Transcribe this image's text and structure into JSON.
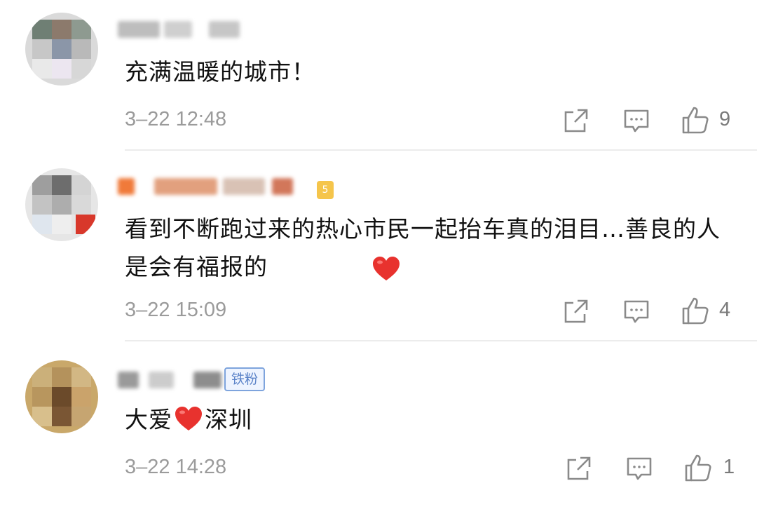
{
  "comments": [
    {
      "text": "充满温暖的城市！",
      "time": "3–22 12:48",
      "likes": "9"
    },
    {
      "text": "看到不断跑过来的热心市民一起抬车真的泪目…善良的人是会有福报的",
      "time": "3–22 15:09",
      "likes": "4"
    },
    {
      "text_before": "大爱",
      "text_after": "深圳",
      "time": "3–22 14:28",
      "likes": "1",
      "badge": "铁粉"
    }
  ],
  "icons": {
    "share": "share-icon",
    "comment": "comment-icon",
    "like": "thumbs-up-icon",
    "heart": "heart-emoji-icon"
  },
  "colors": {
    "text": "#111111",
    "meta": "#9b9b9b",
    "divider": "#ececec",
    "badge": "#5b83c8",
    "heart": "#e8322e"
  }
}
